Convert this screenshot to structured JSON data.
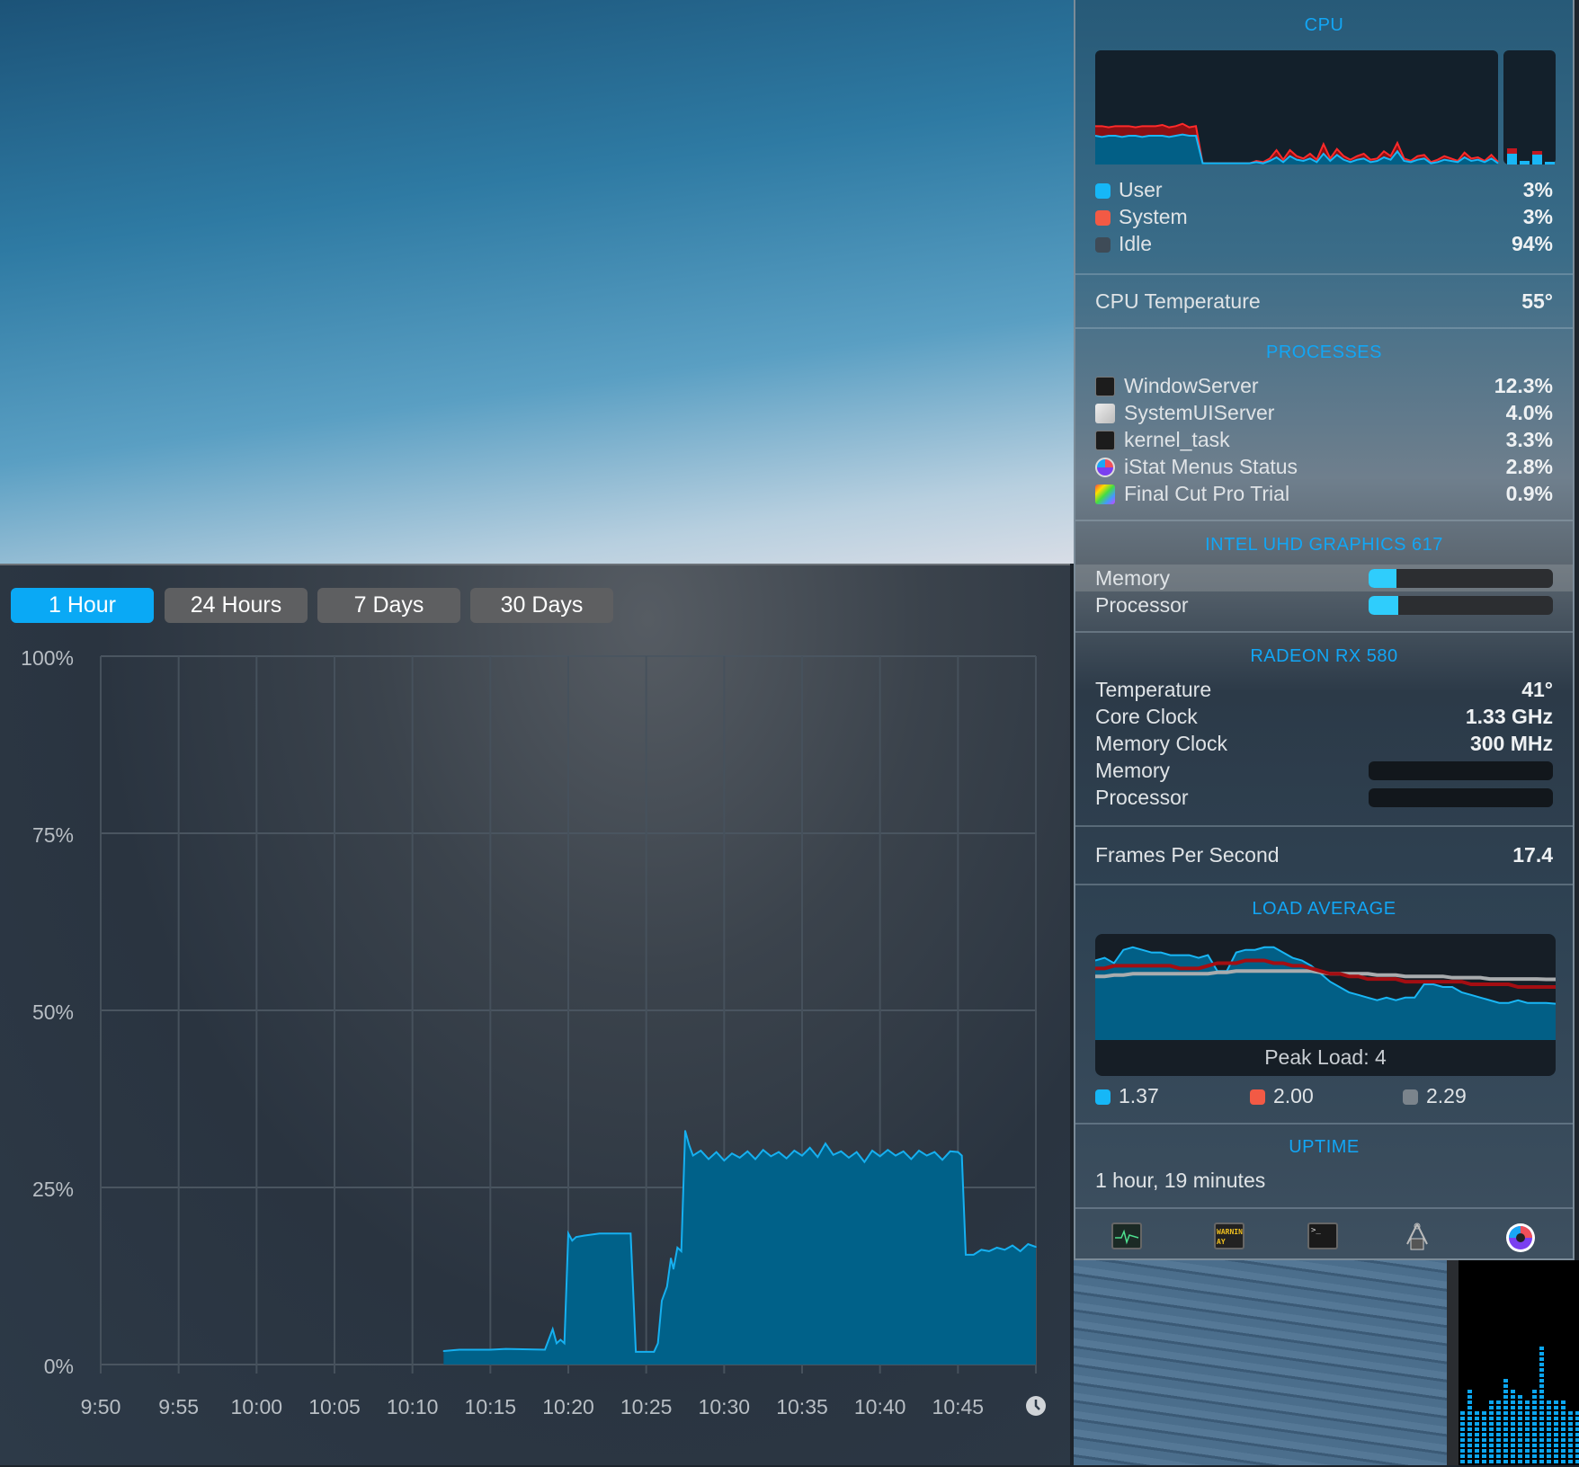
{
  "tabs": [
    {
      "label": "1 Hour",
      "active": true
    },
    {
      "label": "24 Hours",
      "active": false
    },
    {
      "label": "7 Days",
      "active": false
    },
    {
      "label": "30 Days",
      "active": false
    }
  ],
  "chart_data": {
    "type": "area",
    "title": "",
    "xlabel": "",
    "ylabel": "",
    "ylim": [
      0,
      100
    ],
    "xlim": [
      "9:50",
      "10:50"
    ],
    "yticks": [
      "100%",
      "75%",
      "50%",
      "25%",
      "0%"
    ],
    "ytick_values": [
      100,
      75,
      50,
      25,
      0
    ],
    "xticks": [
      "9:50",
      "9:55",
      "10:00",
      "10:05",
      "10:10",
      "10:15",
      "10:20",
      "10:25",
      "10:30",
      "10:35",
      "10:40",
      "10:45"
    ],
    "grid": true,
    "color": "#16b0f0",
    "fill": "#006189",
    "points": [
      [
        "10:12:00",
        1.9
      ],
      [
        "10:13:00",
        2.1
      ],
      [
        "10:15:00",
        2.1
      ],
      [
        "10:16:00",
        2.2
      ],
      [
        "10:18:30",
        2.1
      ],
      [
        "10:19:00",
        5.0
      ],
      [
        "10:19:15",
        3.0
      ],
      [
        "10:19:30",
        3.5
      ],
      [
        "10:19:45",
        3.0
      ],
      [
        "10:20:00",
        18.5
      ],
      [
        "10:20:15",
        17.5
      ],
      [
        "10:20:30",
        18.0
      ],
      [
        "10:21:00",
        18.2
      ],
      [
        "10:22:00",
        18.5
      ],
      [
        "10:24:00",
        18.5
      ],
      [
        "10:24:20",
        1.8
      ],
      [
        "10:25:30",
        1.8
      ],
      [
        "10:25:45",
        3.0
      ],
      [
        "10:26:00",
        9.0
      ],
      [
        "10:26:20",
        11.0
      ],
      [
        "10:26:35",
        15.0
      ],
      [
        "10:26:45",
        13.5
      ],
      [
        "10:27:00",
        16.5
      ],
      [
        "10:27:15",
        16.0
      ],
      [
        "10:27:30",
        33.0
      ],
      [
        "10:27:45",
        31.0
      ],
      [
        "10:28:00",
        29.5
      ],
      [
        "10:28:30",
        30.2
      ],
      [
        "10:29:00",
        29.0
      ],
      [
        "10:29:30",
        30.0
      ],
      [
        "10:30:00",
        28.8
      ],
      [
        "10:30:30",
        29.8
      ],
      [
        "10:31:00",
        29.2
      ],
      [
        "10:31:30",
        30.1
      ],
      [
        "10:32:00",
        29.0
      ],
      [
        "10:32:30",
        30.3
      ],
      [
        "10:33:00",
        29.4
      ],
      [
        "10:33:30",
        30.0
      ],
      [
        "10:34:00",
        29.1
      ],
      [
        "10:34:30",
        30.2
      ],
      [
        "10:35:00",
        29.5
      ],
      [
        "10:35:30",
        30.6
      ],
      [
        "10:36:00",
        29.3
      ],
      [
        "10:36:30",
        31.2
      ],
      [
        "10:37:00",
        29.6
      ],
      [
        "10:37:30",
        30.1
      ],
      [
        "10:38:00",
        29.2
      ],
      [
        "10:38:30",
        30.0
      ],
      [
        "10:39:00",
        28.6
      ],
      [
        "10:39:30",
        30.2
      ],
      [
        "10:40:00",
        29.4
      ],
      [
        "10:40:30",
        30.3
      ],
      [
        "10:41:00",
        29.5
      ],
      [
        "10:41:30",
        30.1
      ],
      [
        "10:42:00",
        29.0
      ],
      [
        "10:42:30",
        30.2
      ],
      [
        "10:43:00",
        29.5
      ],
      [
        "10:43:30",
        30.0
      ],
      [
        "10:44:00",
        28.9
      ],
      [
        "10:44:30",
        30.1
      ],
      [
        "10:45:00",
        30.0
      ],
      [
        "10:45:15",
        29.5
      ],
      [
        "10:45:30",
        15.5
      ],
      [
        "10:46:00",
        15.5
      ],
      [
        "10:46:30",
        16.2
      ],
      [
        "10:47:00",
        16.0
      ],
      [
        "10:47:30",
        16.5
      ],
      [
        "10:48:00",
        16.2
      ],
      [
        "10:48:30",
        16.8
      ],
      [
        "10:49:00",
        16.0
      ],
      [
        "10:49:30",
        17.0
      ],
      [
        "10:50:00",
        16.6
      ]
    ]
  },
  "cpu": {
    "title": "CPU",
    "legend": [
      {
        "label": "User",
        "value": "3%",
        "color": "#16b7f7"
      },
      {
        "label": "System",
        "value": "3%",
        "color": "#f25a45"
      },
      {
        "label": "Idle",
        "value": "94%",
        "color": "#3e4b57"
      }
    ],
    "history_user": [
      24,
      23,
      24,
      24,
      23,
      24,
      24,
      23,
      24,
      24,
      24,
      23,
      24,
      25,
      24,
      24,
      1,
      1,
      1,
      1,
      1,
      1,
      1,
      1,
      2,
      1,
      3,
      6,
      2,
      7,
      4,
      3,
      5,
      2,
      9,
      3,
      8,
      4,
      2,
      4,
      5,
      2,
      3,
      6,
      4,
      11,
      3,
      2,
      4,
      5,
      1,
      2,
      4,
      3,
      2,
      6,
      3,
      4,
      2,
      5,
      1
    ],
    "history_system": [
      8,
      9,
      7,
      8,
      9,
      8,
      7,
      9,
      8,
      8,
      9,
      8,
      8,
      9,
      7,
      8,
      0,
      0,
      0,
      0,
      0,
      0,
      0,
      0,
      1,
      1,
      2,
      6,
      2,
      5,
      3,
      2,
      4,
      2,
      8,
      2,
      5,
      3,
      2,
      3,
      4,
      2,
      2,
      5,
      3,
      7,
      2,
      1,
      3,
      3,
      1,
      2,
      3,
      2,
      1,
      4,
      2,
      2,
      1,
      3,
      1
    ],
    "temperature_label": "CPU Temperature",
    "temperature_value": "55°"
  },
  "processes": {
    "title": "PROCESSES",
    "items": [
      {
        "name": "WindowServer",
        "value": "12.3%",
        "icon": "terminal-icon"
      },
      {
        "name": "SystemUIServer",
        "value": "4.0%",
        "icon": "app-document-icon"
      },
      {
        "name": "kernel_task",
        "value": "3.3%",
        "icon": "terminal-icon"
      },
      {
        "name": "iStat Menus Status",
        "value": "2.8%",
        "icon": "istat-icon"
      },
      {
        "name": "Final Cut Pro Trial",
        "value": "0.9%",
        "icon": "final-cut-icon"
      }
    ]
  },
  "intel_gpu": {
    "title": "INTEL UHD GRAPHICS 617",
    "memory_label": "Memory",
    "memory_level": 0.15,
    "processor_label": "Processor",
    "processor_level": 0.16
  },
  "radeon": {
    "title": "RADEON RX 580",
    "rows": [
      {
        "label": "Temperature",
        "value": "41°"
      },
      {
        "label": "Core Clock",
        "value": "1.33 GHz"
      },
      {
        "label": "Memory Clock",
        "value": "300 MHz"
      }
    ],
    "memory_label": "Memory",
    "memory_level": 0,
    "processor_label": "Processor",
    "processor_level": 0
  },
  "fps": {
    "label": "Frames Per Second",
    "value": "17.4"
  },
  "load": {
    "title": "LOAD AVERAGE",
    "peak": "Peak Load: 4",
    "max": 4,
    "one": [
      3.0,
      3.1,
      2.9,
      3.4,
      3.5,
      3.4,
      3.3,
      3.3,
      3.2,
      3.2,
      3.2,
      3.1,
      3.2,
      2.6,
      2.6,
      3.3,
      3.4,
      3.4,
      3.5,
      3.5,
      3.3,
      3.1,
      3.0,
      2.8,
      2.5,
      2.2,
      2.0,
      1.8,
      1.7,
      1.6,
      1.5,
      1.6,
      1.5,
      1.6,
      1.6,
      2.1,
      2.1,
      2.0,
      2.0,
      1.8,
      1.7,
      1.6,
      1.5,
      1.4,
      1.4,
      1.5,
      1.4,
      1.4,
      1.4,
      1.37
    ],
    "five": [
      2.7,
      2.7,
      2.8,
      2.8,
      2.8,
      2.8,
      2.8,
      2.8,
      2.8,
      2.7,
      2.7,
      2.7,
      2.8,
      2.9,
      2.9,
      2.9,
      3.0,
      3.0,
      3.0,
      2.9,
      2.9,
      2.8,
      2.8,
      2.7,
      2.6,
      2.5,
      2.5,
      2.4,
      2.4,
      2.3,
      2.3,
      2.3,
      2.3,
      2.2,
      2.2,
      2.2,
      2.2,
      2.2,
      2.2,
      2.2,
      2.1,
      2.1,
      2.1,
      2.1,
      2.1,
      2.0,
      2.0,
      2.0,
      2.0,
      2.0
    ],
    "fifteen": [
      2.4,
      2.4,
      2.45,
      2.45,
      2.5,
      2.5,
      2.5,
      2.5,
      2.5,
      2.5,
      2.5,
      2.5,
      2.5,
      2.55,
      2.55,
      2.6,
      2.6,
      2.6,
      2.6,
      2.6,
      2.6,
      2.6,
      2.6,
      2.6,
      2.55,
      2.5,
      2.5,
      2.5,
      2.5,
      2.5,
      2.45,
      2.45,
      2.45,
      2.4,
      2.4,
      2.4,
      2.4,
      2.4,
      2.35,
      2.35,
      2.35,
      2.35,
      2.3,
      2.3,
      2.3,
      2.3,
      2.3,
      2.3,
      2.29,
      2.29
    ],
    "legend": [
      {
        "value": "1.37",
        "color": "#16b7f7"
      },
      {
        "value": "2.00",
        "color": "#f25a45"
      },
      {
        "value": "2.29",
        "color": "#7b848c"
      }
    ]
  },
  "uptime": {
    "title": "UPTIME",
    "value": "1 hour, 19 minutes"
  },
  "toolbar": [
    "activity-monitor-icon",
    "console-icon",
    "terminal-icon",
    "system-information-icon",
    "istat-menus-icon"
  ]
}
